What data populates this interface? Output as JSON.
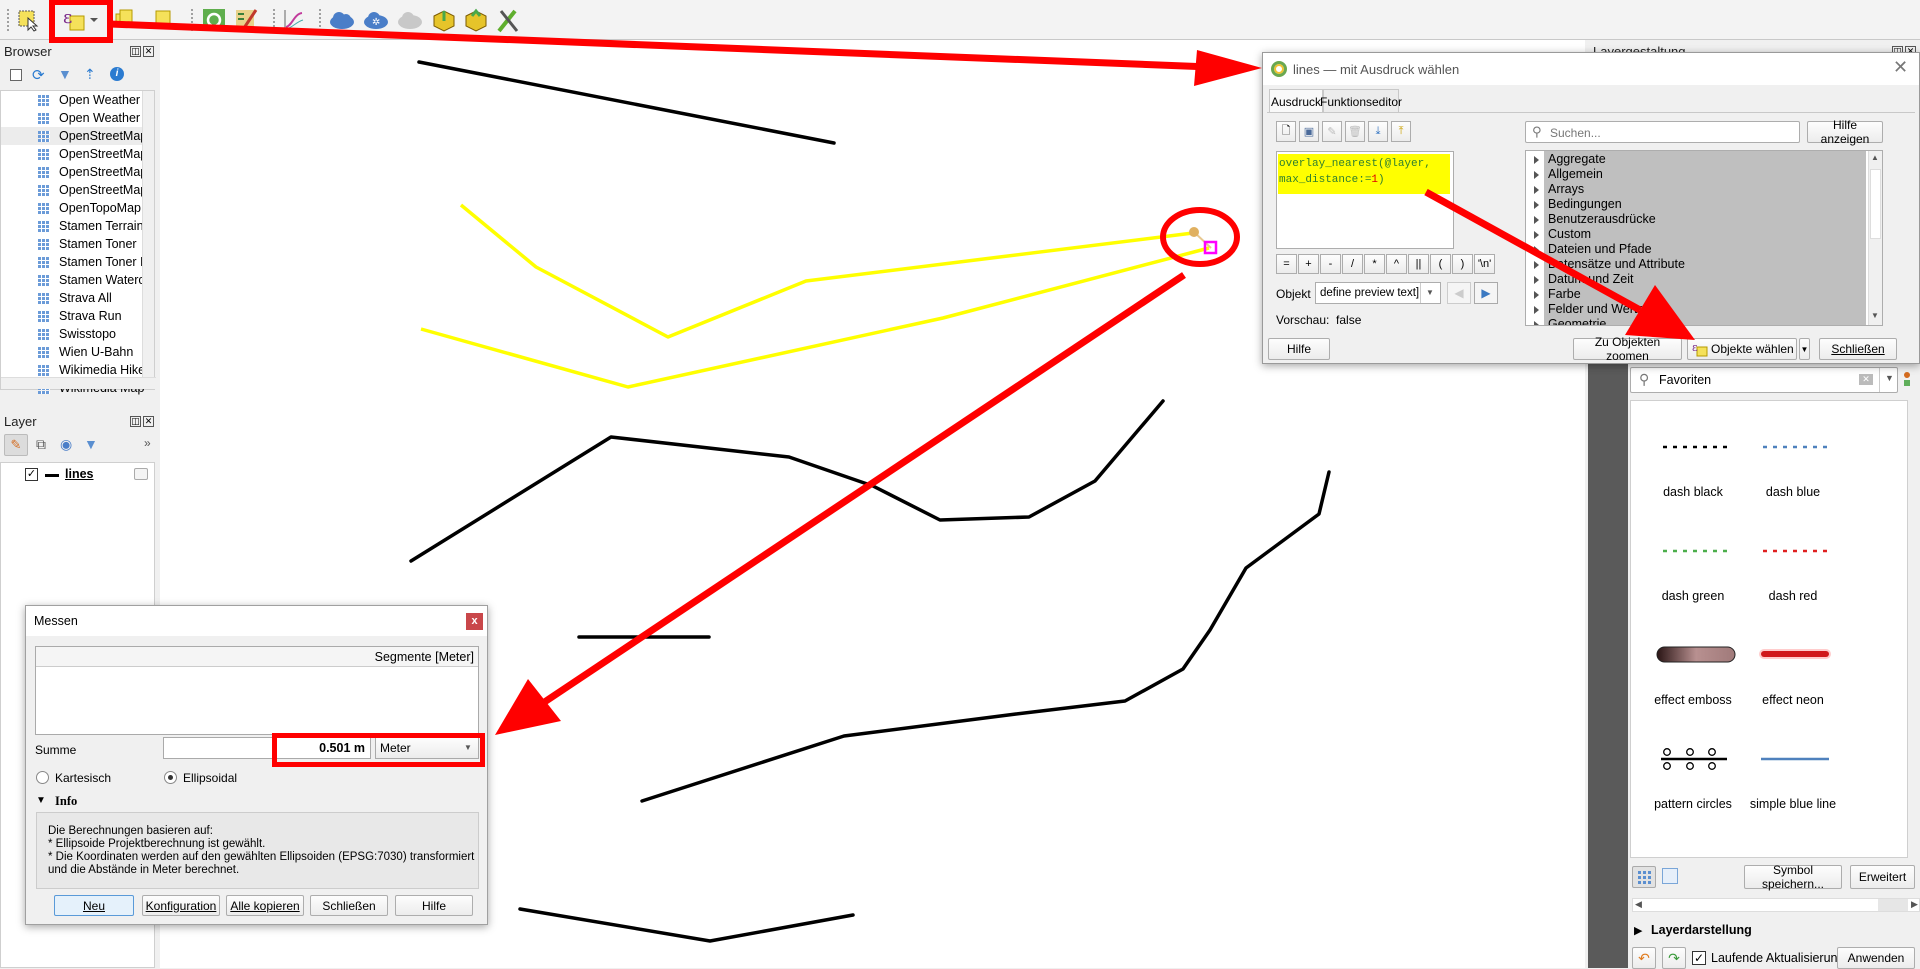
{
  "toolbar": {
    "icons": [
      "select-features-icon",
      "select-by-expression-icon",
      "dropdown-arrow-icon",
      "select-by-value-icon",
      "deselect-icon",
      "identify-icon",
      "field-calculator-icon",
      "profile-tool-icon",
      "cloud-icon",
      "cloud-settings-icon",
      "cloud-sync-icon",
      "add-layer-icon",
      "add-feature-icon",
      "processing-tools-icon"
    ]
  },
  "browser": {
    "title": "Browser",
    "items": [
      "Open Weather Map",
      "Open Weather Map",
      "OpenStreetMap",
      "OpenStreetMap",
      "OpenStreetMap",
      "OpenStreetMap",
      "OpenTopoMap",
      "Stamen Terrain",
      "Stamen Toner",
      "Stamen Toner Lite",
      "Stamen Watercolor",
      "Strava All",
      "Strava Run",
      "Swisstopo",
      "Wien U-Bahn",
      "Wikimedia Hike",
      "Wikimedia Map"
    ],
    "selected_index": 2
  },
  "layers": {
    "title": "Layer",
    "items": [
      {
        "name": "lines",
        "checked": true
      }
    ]
  },
  "expression_dialog": {
    "title": "lines — mit Ausdruck wählen",
    "tabs": [
      "Ausdruck",
      "Funktionseditor"
    ],
    "active_tab": "Ausdruck",
    "expression_line1": "overlay_nearest(@layer,",
    "expression_line2_prefix": "max_distance:=",
    "expression_line2_number": "1",
    "expression_line2_suffix": ")",
    "operators": [
      "=",
      "+",
      "-",
      "/",
      "*",
      "^",
      "||",
      "(",
      ")",
      "'\\n'"
    ],
    "object_label": "Objekt",
    "object_value": "define preview text]",
    "preview_label": "Vorschau:",
    "preview_value": "false",
    "search_placeholder": "Suchen...",
    "help_button": "Hilfe anzeigen",
    "functions": [
      "Aggregate",
      "Allgemein",
      "Arrays",
      "Bedingungen",
      "Benutzerausdrücke",
      "Custom",
      "Dateien und Pfade",
      "Datensätze und Attribute",
      "Datum und Zeit",
      "Farbe",
      "Felder und Werte",
      "Geometrie"
    ],
    "buttons": {
      "help": "Hilfe",
      "zoom": "Zu Objekten zoomen",
      "select": "Objekte wählen",
      "close": "Schließen"
    }
  },
  "layer_styling": {
    "title": "Layergestaltung",
    "search_value": "Favoriten",
    "symbols": [
      {
        "name": "dash  black",
        "type": "dash",
        "color": "#000000"
      },
      {
        "name": "dash blue",
        "type": "dash",
        "color": "#4f81bd"
      },
      {
        "name": "dash green",
        "type": "dash",
        "color": "#4cae4c"
      },
      {
        "name": "dash red",
        "type": "dash",
        "color": "#e02020"
      },
      {
        "name": "effect emboss",
        "type": "emboss",
        "color": "#8a5a5a"
      },
      {
        "name": "effect neon",
        "type": "neon",
        "color": "#d0191c"
      },
      {
        "name": "pattern circles",
        "type": "circles",
        "color": "#000000"
      },
      {
        "name": "simple blue line",
        "type": "line",
        "color": "#4f81bd"
      }
    ],
    "save_symbol": "Symbol speichern...",
    "advanced": "Erweitert",
    "layer_rendering": "Layerdarstellung",
    "live_update": "Laufende Aktualisierung",
    "live_update_checked": true,
    "apply": "Anwenden"
  },
  "measure_dialog": {
    "title": "Messen",
    "close": "x",
    "segments_header": "Segmente [Meter]",
    "total_label": "Summe",
    "total_value": "0.501 m",
    "unit": "Meter",
    "radio_cartesian": "Kartesisch",
    "radio_ellipsoidal": "Ellipsoidal",
    "selected_mode": "Ellipsoidal",
    "info_label": "Info",
    "info_lines": [
      "Die Berechnungen basieren auf:",
      "* Ellipsoide Projektberechnung ist gewählt.",
      "* Die Koordinaten werden auf den gewählten Ellipsoiden (EPSG:7030) transformiert",
      "und die Abstände in Meter berechnet."
    ],
    "buttons": [
      "Neu",
      "Konfiguration",
      "Alle kopieren",
      "Schließen",
      "Hilfe"
    ]
  },
  "colors": {
    "annotation": "#ff0000",
    "highlight": "#ffff00",
    "selected_line": "#ffff00",
    "map_line": "#000000"
  }
}
